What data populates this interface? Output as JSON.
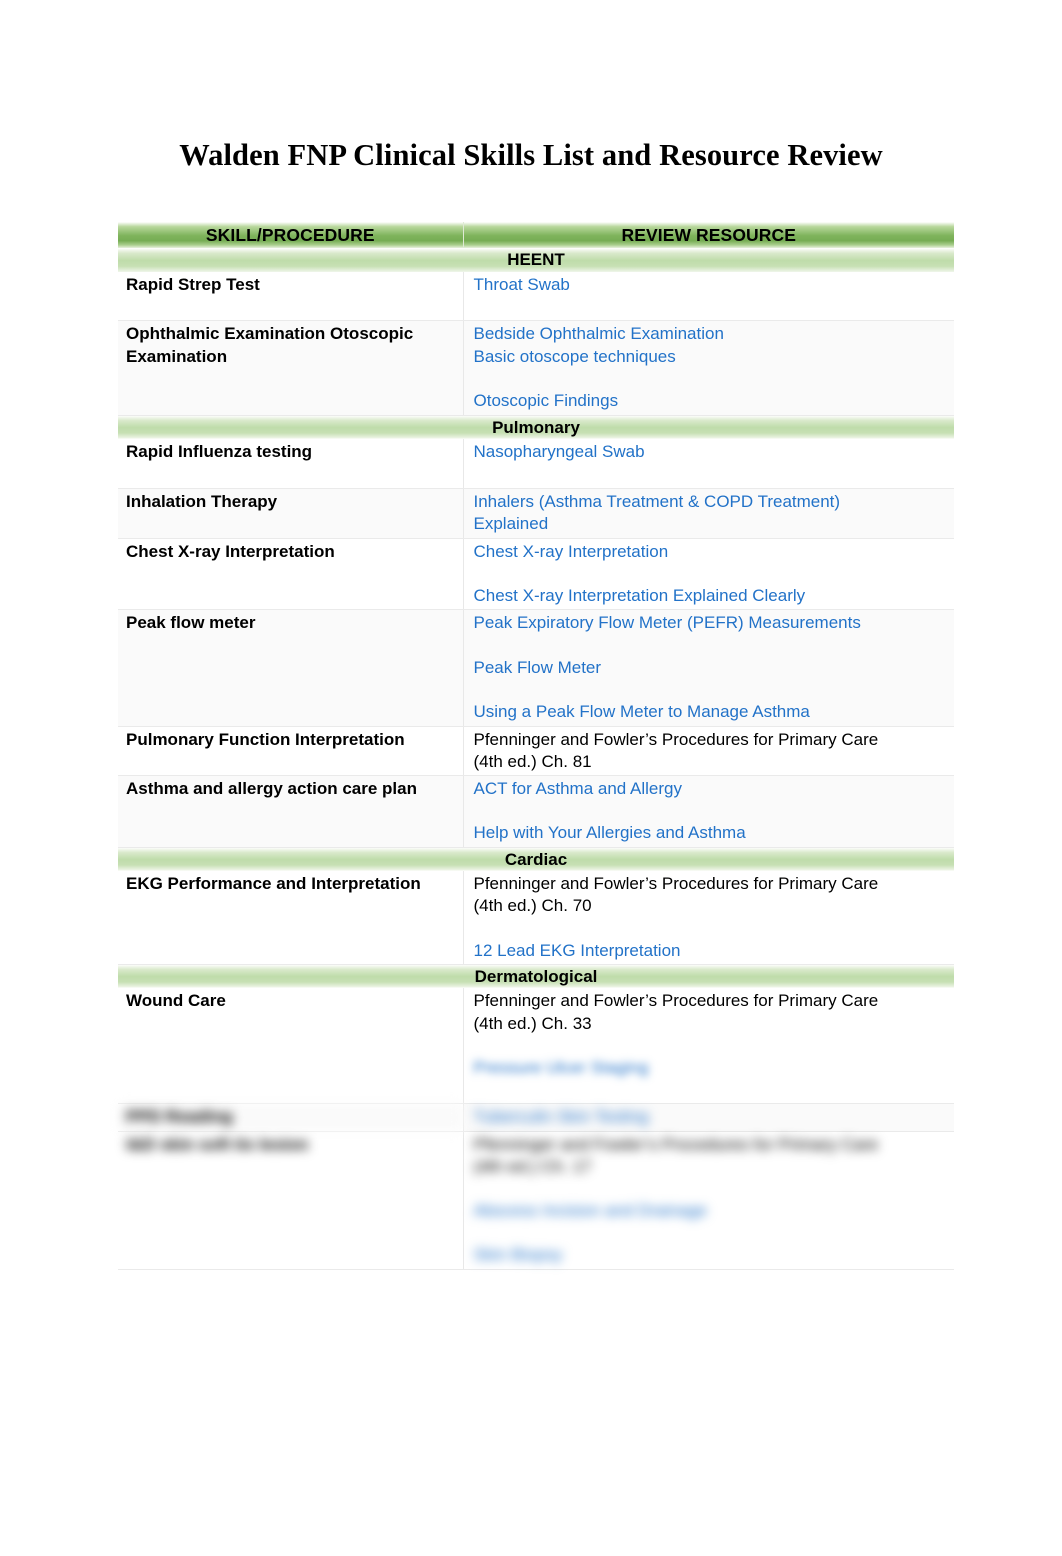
{
  "document": {
    "title": "Walden FNP Clinical Skills List and Resource Review"
  },
  "table": {
    "columns": {
      "skill": "SKILL/PROCEDURE",
      "resource": "REVIEW RESOURCE"
    },
    "sections": [
      {
        "name": "HEENT"
      },
      {
        "name": "Pulmonary"
      },
      {
        "name": "Cardiac"
      },
      {
        "name": "Dermatological"
      }
    ],
    "rows": {
      "r1_skill": "Rapid Strep Test",
      "r1_link1": "Throat Swab",
      "r2_skill_a": "Ophthalmic Examination",
      "r2_skill_b": "Otoscopic Examination",
      "r2_link1": "Bedside Ophthalmic Examination",
      "r2_link2": "Basic otoscope techniques",
      "r2_link3": "Otoscopic Findings",
      "r3_skill": "Rapid Influenza testing",
      "r3_link1": "Nasopharyngeal Swab",
      "r4_skill": "Inhalation Therapy",
      "r4_link1": "Inhalers (Asthma Treatment & COPD Treatment)",
      "r4_link1b": "Explained",
      "r5_skill": "Chest X-ray  Interpretation",
      "r5_link1": "Chest X-ray Interpretation",
      "r5_link2": "Chest X-ray Interpretation Explained Clearly",
      "r6_skill": "Peak flow meter",
      "r6_link1": "Peak Expiratory Flow Meter (PEFR) Measurements",
      "r6_link2": "Peak Flow Meter",
      "r6_link3": "Using a Peak Flow Meter to Manage Asthma",
      "r7_skill": "Pulmonary Function Interpretation",
      "r7_text1": "Pfenninger and Fowler’s Procedures for Primary Care",
      "r7_text2": "(4th ed.) Ch. 81",
      "r8_skill": "Asthma and allergy action care plan",
      "r8_link1": "ACT for Asthma and Allergy",
      "r8_link2": "Help with Your Allergies and Asthma",
      "r9_skill_a": "EKG Performance and",
      "r9_skill_b": "Interpretation",
      "r9_text1": "Pfenninger and Fowler’s Procedures for Primary Care",
      "r9_text2": "(4th ed.) Ch. 70",
      "r9_link1": "12 Lead EKG Interpretation",
      "r10_skill": "Wound Care",
      "r10_text1": "Pfenninger and Fowler’s Procedures for Primary Care",
      "r10_text2": "(4th ed.)  Ch. 33",
      "r10_link1": "Pressure Ulcer Staging",
      "r11_skill": "PPD Reading",
      "r11_link1": "Tuberculin Skin Testing",
      "r12_skill": "I&D skin soft tis lesion",
      "r12_text1": "Pfenninger and Fowler’s Procedures for Primary Care",
      "r12_text2": "(4th ed.) Ch. 17",
      "r12_link1": "Abscess Incision and Drainage",
      "r12_link2": "Skin Biopsy"
    }
  },
  "colors": {
    "header_green_dark": "#76ad54",
    "header_green_light": "#b8d79c",
    "section_green": "#bfdcaa",
    "link_blue": "#2272c8",
    "text_black": "#000000",
    "rule_gray": "#eaeaea"
  }
}
